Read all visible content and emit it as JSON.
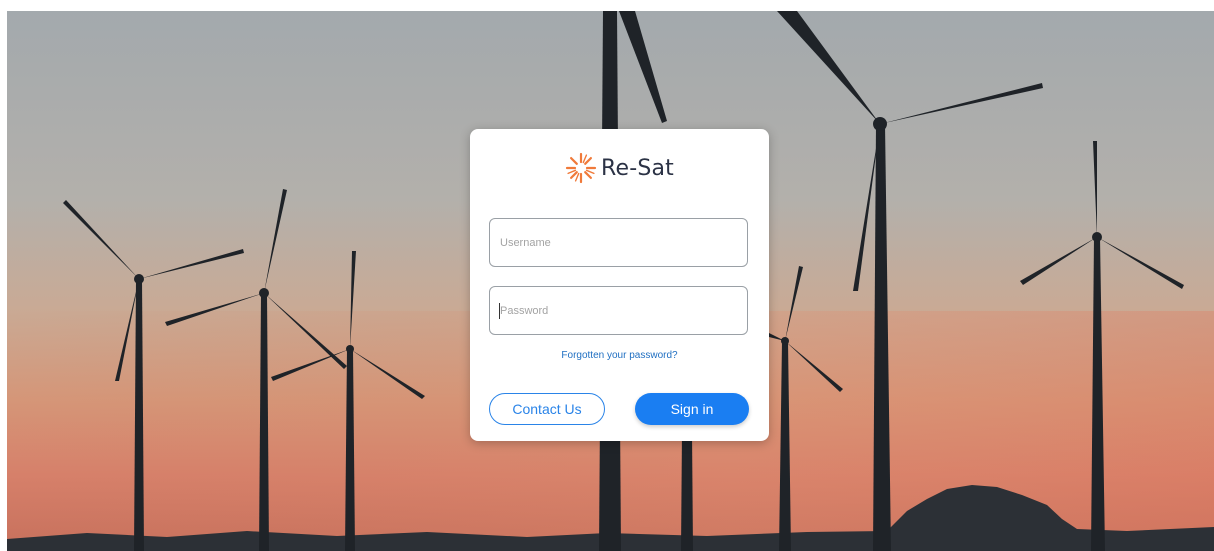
{
  "brand": {
    "name": "Re-Sat",
    "logo_icon": "sunburst-icon",
    "logo_color": "#f07a3a"
  },
  "form": {
    "username": {
      "placeholder": "Username",
      "value": ""
    },
    "password": {
      "placeholder": "Password",
      "value": ""
    },
    "forgot_link": "Forgotten your password?",
    "contact_button": "Contact Us",
    "signin_button": "Sign in"
  },
  "colors": {
    "accent": "#1a7ef2",
    "link": "#1f6fc2",
    "brand_text": "#2b3245"
  },
  "background": {
    "image": "wind-turbines-sunset"
  }
}
